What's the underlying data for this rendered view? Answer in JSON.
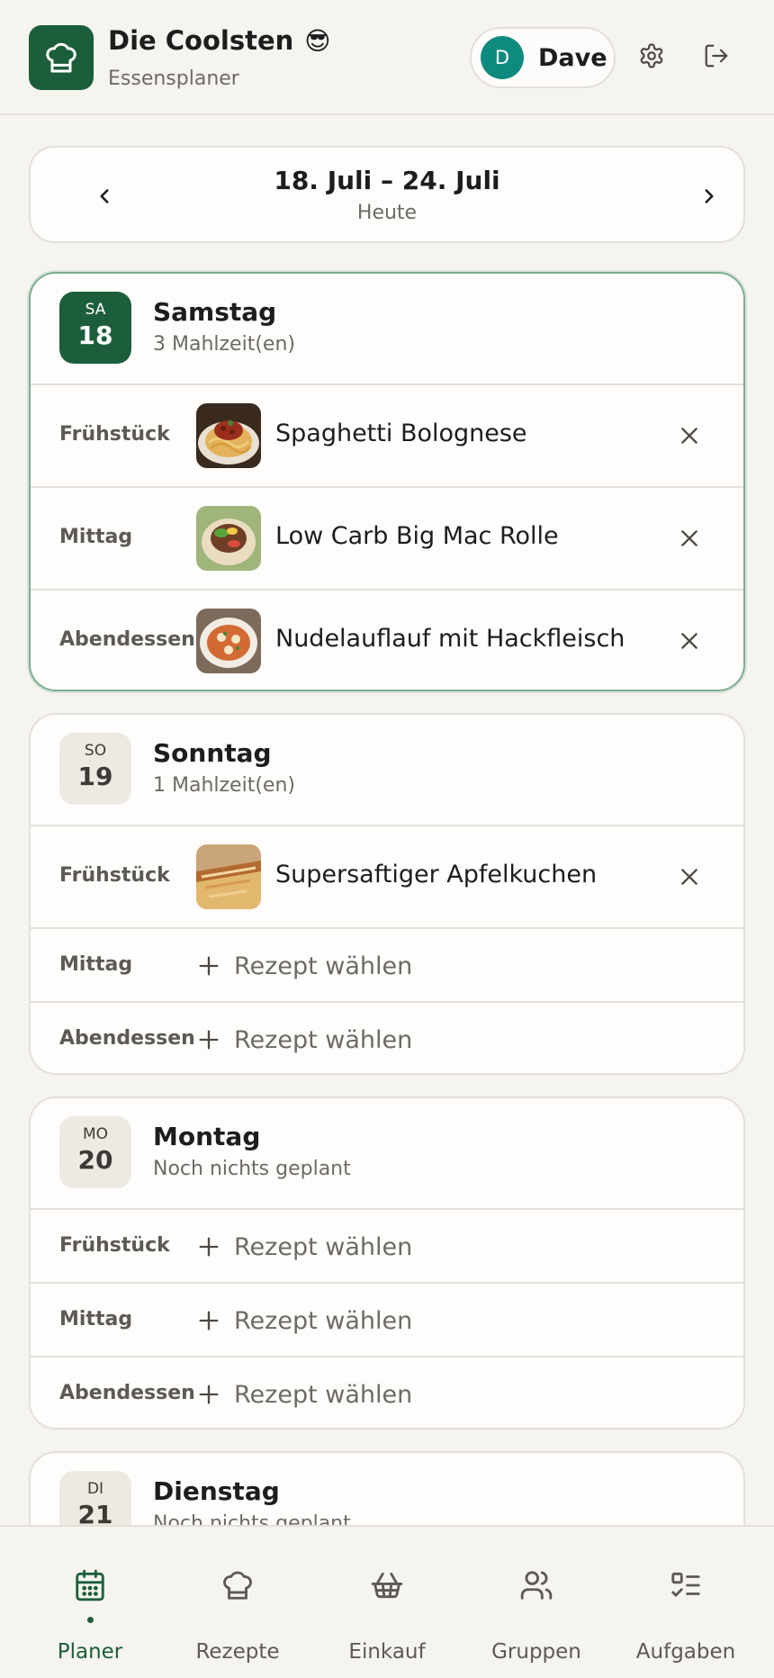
{
  "header": {
    "title": "Die Coolsten",
    "title_emoji": "😎",
    "subtitle": "Essensplaner",
    "user_initial": "D",
    "user_name": "Dave",
    "icons": [
      "chef-hat-icon",
      "gear-icon",
      "logout-icon"
    ]
  },
  "week": {
    "range": "18. Juli – 24. Juli",
    "subtitle": "Heute"
  },
  "days": [
    {
      "abbr": "SA",
      "num": "18",
      "name": "Samstag",
      "count": "3 Mahlzeit(en)",
      "meals": [
        {
          "label": "Frühstück",
          "name": "Spaghetti Bolognese"
        },
        {
          "label": "Mittag",
          "name": "Low Carb Big Mac Rolle"
        },
        {
          "label": "Abendessen",
          "name": "Nudelauflauf mit Hackfleisch"
        }
      ]
    },
    {
      "abbr": "SO",
      "num": "19",
      "name": "Sonntag",
      "count": "1 Mahlzeit(en)",
      "meals": [
        {
          "label": "Frühstück",
          "name": "Supersaftiger Apfelkuchen"
        },
        {
          "label": "Mittag",
          "add": "Rezept wählen"
        },
        {
          "label": "Abendessen",
          "add": "Rezept wählen"
        }
      ]
    },
    {
      "abbr": "MO",
      "num": "20",
      "name": "Montag",
      "count": "Noch nichts geplant",
      "meals": [
        {
          "label": "Frühstück",
          "add": "Rezept wählen"
        },
        {
          "label": "Mittag",
          "add": "Rezept wählen"
        },
        {
          "label": "Abendessen",
          "add": "Rezept wählen"
        }
      ]
    },
    {
      "abbr": "DI",
      "num": "21",
      "name": "Dienstag",
      "count": "Noch nichts geplant"
    }
  ],
  "nav": {
    "items": [
      {
        "label": "Planer",
        "icon": "calendar-icon",
        "active": true
      },
      {
        "label": "Rezepte",
        "icon": "chef-hat-icon"
      },
      {
        "label": "Einkauf",
        "icon": "basket-icon"
      },
      {
        "label": "Gruppen",
        "icon": "users-icon"
      },
      {
        "label": "Aufgaben",
        "icon": "checklist-icon"
      }
    ]
  },
  "colors": {
    "brand": "#1c5e3c",
    "avatar": "#0f8a7e",
    "background": "#f6f4ef",
    "card": "#fefdfb",
    "border": "#e3e0d9",
    "today_border": "#7fae92"
  }
}
